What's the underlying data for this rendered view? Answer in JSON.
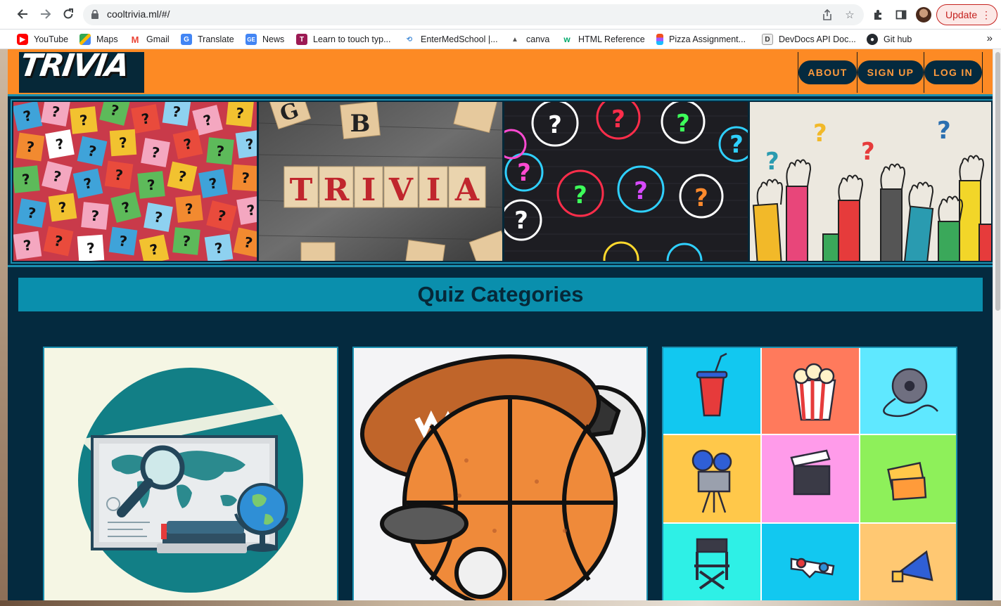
{
  "browser": {
    "url": "cooltrivia.ml/#/",
    "update_label": "Update",
    "bookmarks": [
      {
        "label": "YouTube",
        "icon": "youtube-icon"
      },
      {
        "label": "Maps",
        "icon": "maps-icon"
      },
      {
        "label": "Gmail",
        "icon": "gmail-icon"
      },
      {
        "label": "Translate",
        "icon": "translate-icon"
      },
      {
        "label": "News",
        "icon": "news-icon"
      },
      {
        "label": "Learn to touch typ...",
        "icon": "typing-icon"
      },
      {
        "label": "EnterMedSchool |...",
        "icon": "entermedschool-icon"
      },
      {
        "label": "canva",
        "icon": "canva-icon"
      },
      {
        "label": "HTML Reference",
        "icon": "w3-icon"
      },
      {
        "label": "Pizza Assignment...",
        "icon": "figma-icon"
      },
      {
        "label": "DevDocs API Doc...",
        "icon": "devdocs-icon"
      },
      {
        "label": "Git hub",
        "icon": "github-icon"
      }
    ],
    "more_bookmarks": "»"
  },
  "site": {
    "logo_text": "TRIVIA",
    "nav": {
      "about": "ABOUT",
      "signup": "SIGN UP",
      "login": "LOG IN"
    },
    "banner_text": "TRIVIA",
    "categories_heading": "Quiz Categories",
    "colors": {
      "header": "#fd8a24",
      "page_bg": "#042a3f",
      "heading_bar": "#0a8fad",
      "accent_border": "#1a8fb0",
      "nav_text": "#ff9b3d"
    }
  }
}
